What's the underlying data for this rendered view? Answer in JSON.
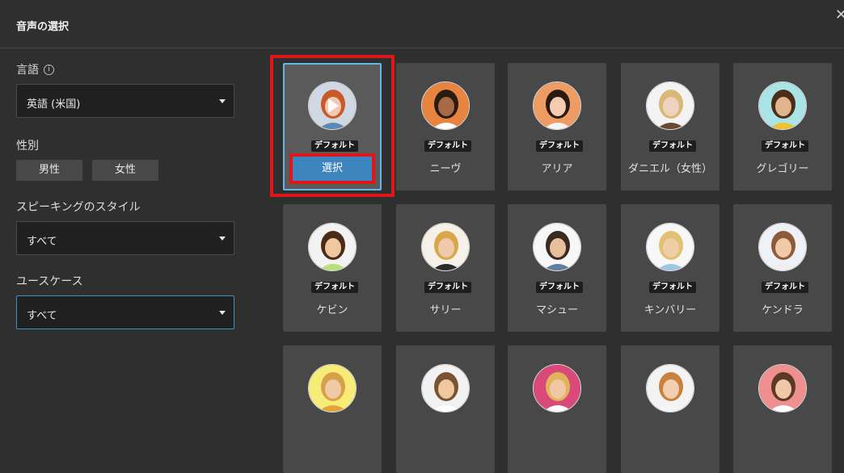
{
  "dialog": {
    "title": "音声の選択",
    "close_icon": "close-icon"
  },
  "filters": {
    "language_label": "言語",
    "language_value": "英語 (米国)",
    "gender_label": "性別",
    "gender_options": [
      "男性",
      "女性"
    ],
    "style_label": "スピーキングのスタイル",
    "style_value": "すべて",
    "usecase_label": "ユースケース",
    "usecase_value": "すべて"
  },
  "voices": [
    {
      "name": "",
      "badge": "デフォルト",
      "select_label": "選択",
      "selected": true,
      "bg": "#cfd8e3",
      "skin": "#f0c9b0",
      "hair": "#c85a2a",
      "shirt": "#5b88b5"
    },
    {
      "name": "ニーヴ",
      "badge": "デフォルト",
      "bg": "#e7843f",
      "skin": "#a86a45",
      "hair": "#2a1b12",
      "shirt": "#ffffff"
    },
    {
      "name": "アリア",
      "badge": "デフォルト",
      "bg": "#ef9b64",
      "skin": "#f2cbb0",
      "hair": "#2b1a12",
      "shirt": "#f5f5f5"
    },
    {
      "name": "ダニエル（女性）",
      "badge": "デフォルト",
      "bg": "#f3f3f3",
      "skin": "#f0d3bf",
      "hair": "#d9b777",
      "shirt": "#6a4a34"
    },
    {
      "name": "グレゴリー",
      "badge": "デフォルト",
      "bg": "#a9e4e7",
      "skin": "#e2b48d",
      "hair": "#4a2d1b",
      "shirt": "#f1c230"
    },
    {
      "name": "ケビン",
      "badge": "デフォルト",
      "bg": "#f2f2f2",
      "skin": "#f0c8a0",
      "hair": "#4a2b18",
      "shirt": "#b8e07a"
    },
    {
      "name": "サリー",
      "badge": "デフォルト",
      "bg": "#f5f1e8",
      "skin": "#f0c9aa",
      "hair": "#d9a64c",
      "shirt": "#2b2b2b"
    },
    {
      "name": "マシュー",
      "badge": "デフォルト",
      "bg": "#f7f7f7",
      "skin": "#e7bf9c",
      "hair": "#3a2a20",
      "shirt": "#5f7f9c"
    },
    {
      "name": "キンバリー",
      "badge": "デフォルト",
      "bg": "#f7f7f7",
      "skin": "#f0cda9",
      "hair": "#e2c174",
      "shirt": "#9dc7e3"
    },
    {
      "name": "ケンドラ",
      "badge": "デフォルト",
      "bg": "#eef1f5",
      "skin": "#f0c9a9",
      "hair": "#8d5a3a",
      "shirt": "#f0f0f0"
    },
    {
      "name": "",
      "badge": "",
      "bg": "#f6ec77",
      "skin": "#f0caa6",
      "hair": "#d9a04a",
      "shirt": "#e3a43b"
    },
    {
      "name": "",
      "badge": "",
      "bg": "#f2f2f2",
      "skin": "#f0c8a0",
      "hair": "#7a5432",
      "shirt": "#ffffff"
    },
    {
      "name": "",
      "badge": "",
      "bg": "#d94a7a",
      "skin": "#f0c7a3",
      "hair": "#e0b35c",
      "shirt": "#ffffff"
    },
    {
      "name": "",
      "badge": "",
      "bg": "#f3f3f3",
      "skin": "#f2cfb1",
      "hair": "#c9813f",
      "shirt": "#f5f5f5"
    },
    {
      "name": "",
      "badge": "",
      "bg": "#ef8f8f",
      "skin": "#f0c7a7",
      "hair": "#5b3924",
      "shirt": "#ffffff"
    }
  ]
}
